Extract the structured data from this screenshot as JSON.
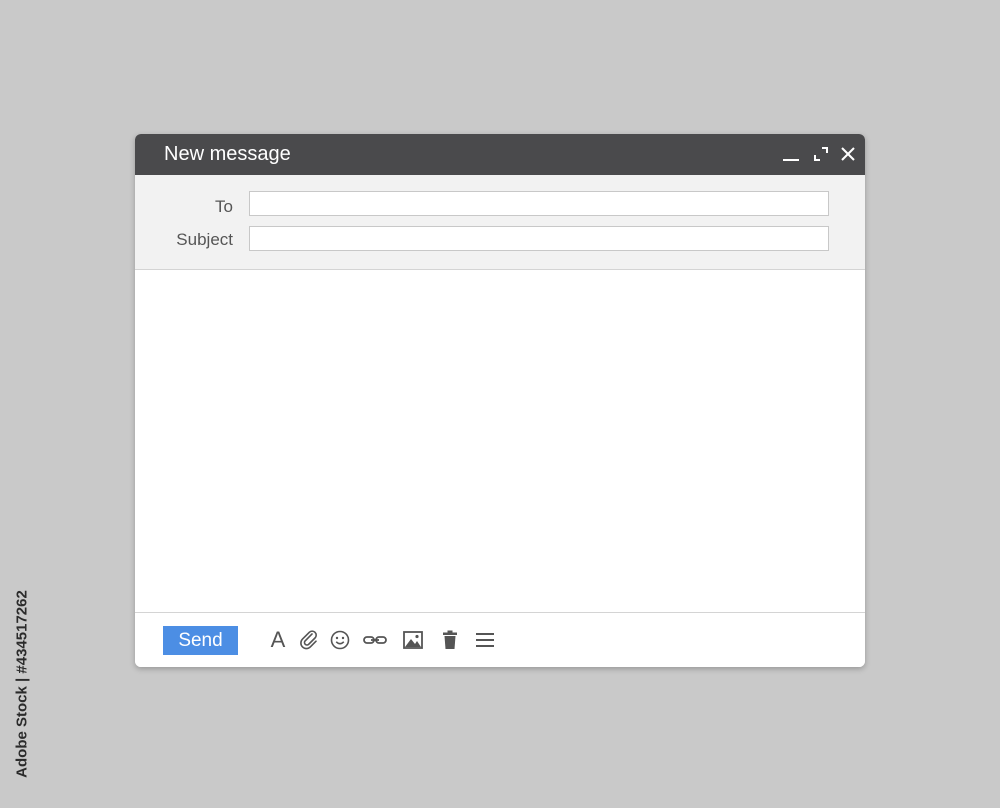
{
  "window": {
    "title": "New message"
  },
  "window_controls": {
    "minimize_icon": "minimize-icon",
    "expand_icon": "expand-icon",
    "close_icon": "close-icon"
  },
  "fields": {
    "to_label": "To",
    "to_value": "",
    "subject_label": "Subject",
    "subject_value": ""
  },
  "body": {
    "value": ""
  },
  "toolbar": {
    "send_label": "Send",
    "format_text_glyph": "A",
    "icons": [
      "format-text-icon",
      "attach-icon",
      "emoji-icon",
      "link-icon",
      "image-icon",
      "delete-icon",
      "more-options-icon"
    ]
  },
  "watermark": {
    "stock_id": "Adobe Stock | #434517262"
  },
  "colors": {
    "background": "#c9c9c9",
    "titlebar": "#4a4a4c",
    "header_area": "#f2f2f2",
    "send_button": "#4c8ee4",
    "icon": "#555555"
  }
}
